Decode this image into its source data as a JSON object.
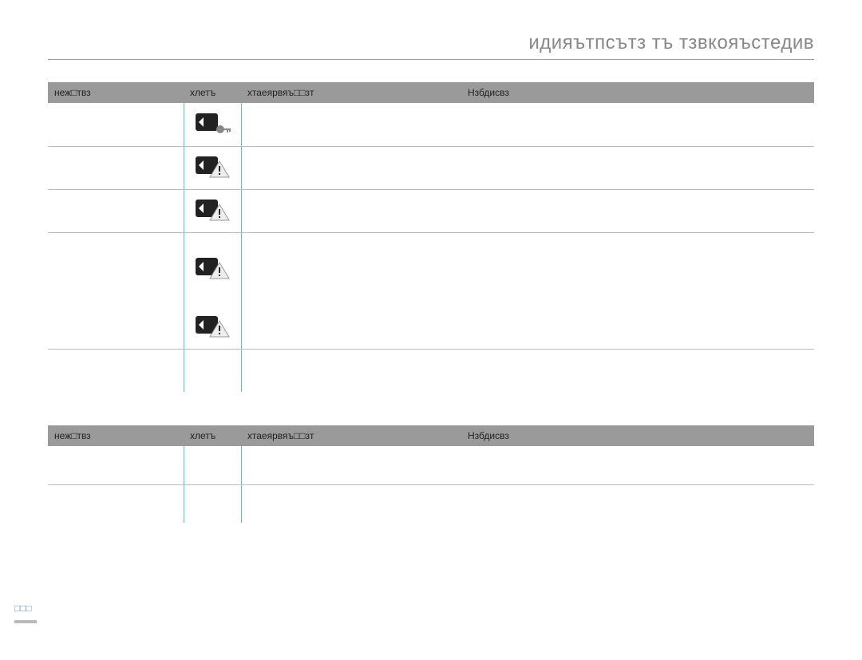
{
  "title": "идияътпсътз тъ тзвкояъстедив",
  "headers": {
    "col1": "неж□твз",
    "col2": "хлетъ",
    "col3": "хтаеярвяъ□□зт",
    "col4": "Нзбдисвз"
  },
  "table1_rows": [
    {
      "icon": "card-key"
    },
    {
      "icon": "card-warn"
    },
    {
      "icon": "card-warn"
    },
    {
      "icon": "card-warn",
      "tall": true,
      "noline": true
    },
    {
      "icon": "card-warn"
    },
    {
      "icon": "",
      "noline": true
    }
  ],
  "table2_rows": [
    {},
    {
      "noline": true
    }
  ],
  "pagenum": "□□□"
}
